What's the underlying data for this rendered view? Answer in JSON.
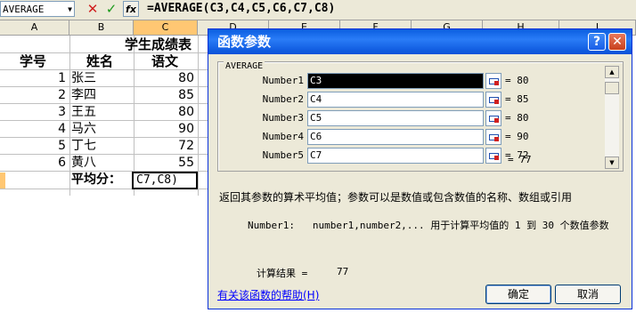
{
  "formula_bar": {
    "name_box": "AVERAGE",
    "formula": "=AVERAGE(C3,C4,C5,C6,C7,C8)",
    "cancel_glyph": "✕",
    "enter_glyph": "✓",
    "fx_glyph": "fx"
  },
  "sheet": {
    "columns": [
      "A",
      "B",
      "C",
      "D",
      "E",
      "F",
      "G",
      "H",
      "I"
    ],
    "title": "学生成绩表",
    "headers": {
      "a": "学号",
      "b": "姓名",
      "c": "语文"
    },
    "rows": [
      {
        "id": "1",
        "name": "张三",
        "score": "80"
      },
      {
        "id": "2",
        "name": "李四",
        "score": "85"
      },
      {
        "id": "3",
        "name": "王五",
        "score": "80"
      },
      {
        "id": "4",
        "name": "马六",
        "score": "90"
      },
      {
        "id": "5",
        "name": "丁七",
        "score": "72"
      },
      {
        "id": "6",
        "name": "黄八",
        "score": "55"
      }
    ],
    "avg_label": "平均分：",
    "active_cell_text": "C7,C8)"
  },
  "dialog": {
    "title": "函数参数",
    "help_glyph": "?",
    "close_glyph": "✕",
    "group_label": "AVERAGE",
    "args": [
      {
        "label": "Number1",
        "value": "C3",
        "result": "= 80"
      },
      {
        "label": "Number2",
        "value": "C4",
        "result": "= 85"
      },
      {
        "label": "Number3",
        "value": "C5",
        "result": "= 80"
      },
      {
        "label": "Number4",
        "value": "C6",
        "result": "= 90"
      },
      {
        "label": "Number5",
        "value": "C7",
        "result": "= 72"
      }
    ],
    "overall_result": "= 77",
    "description": "返回其参数的算术平均值；参数可以是数值或包含数值的名称、数组或引用",
    "arg_description": "Number1:   number1,number2,... 用于计算平均值的 1 到 30 个数值参数",
    "calc_label": "计算结果 =",
    "calc_value": "77",
    "help_link": "有关该函数的帮助(H)",
    "ok_label": "确定",
    "cancel_label": "取消"
  }
}
